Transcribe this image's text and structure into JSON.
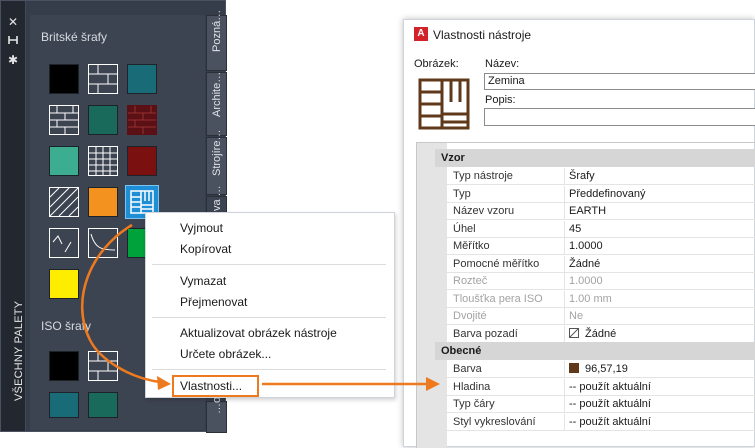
{
  "palette": {
    "title": "VŠECHNY PALETY",
    "section1_label": "Britské šrafy",
    "section2_label": "ISO šrafy",
    "tabs": [
      "Pozná…",
      "Archite…",
      "Strojíre…",
      "va …",
      "…oní"
    ],
    "colors": {
      "teal": "#1a6b78",
      "green": "#1a6a5c",
      "mint": "#3cae8f",
      "maroon": "#7b1010",
      "orange": "#f4921f",
      "yellow": "#ffed00",
      "black": "#000000",
      "brightgreen": "#00a23c",
      "highlight": "#1e8fd6"
    }
  },
  "context_menu": {
    "items": [
      "Vyjmout",
      "Kopírovat",
      "Vymazat",
      "Přejmenovat",
      "Aktualizovat obrázek nástroje",
      "Určete obrázek...",
      "Vlastnosti..."
    ],
    "highlight_color": "#ee7a1f"
  },
  "dialog": {
    "title": "Vlastnosti nástroje",
    "image_label": "Obrázek:",
    "name_label": "Název:",
    "name_value": "Zemina",
    "desc_label": "Popis:",
    "desc_value": "",
    "sections": [
      {
        "title": "Vzor",
        "rows": [
          {
            "name": "Typ nástroje",
            "value": "Šrafy",
            "gray": false
          },
          {
            "name": "Typ",
            "value": "Předdefinovaný",
            "gray": false
          },
          {
            "name": "Název vzoru",
            "value": "EARTH",
            "gray": false
          },
          {
            "name": "Úhel",
            "value": "45",
            "gray": false
          },
          {
            "name": "Měřítko",
            "value": "1.0000",
            "gray": false
          },
          {
            "name": "Pomocné měřítko",
            "value": "Žádné",
            "gray": false
          },
          {
            "name": "Rozteč",
            "value": "1.0000",
            "gray": true
          },
          {
            "name": "Tloušťka pera ISO",
            "value": "1.00 mm",
            "gray": true
          },
          {
            "name": "Dvojité",
            "value": "Ne",
            "gray": true
          },
          {
            "name": "Barva pozadí",
            "value": "Žádné",
            "gray": false
          }
        ]
      },
      {
        "title": "Obecné",
        "rows": [
          {
            "name": "Barva",
            "value": "96,57,19",
            "gray": false
          },
          {
            "name": "Hladina",
            "value": "-- použít aktuální",
            "gray": false
          },
          {
            "name": "Typ čáry",
            "value": "-- použít aktuální",
            "gray": false
          },
          {
            "name": "Styl vykreslování",
            "value": "-- použít aktuální",
            "gray": false
          }
        ]
      }
    ],
    "colors": {
      "accent": "#d2232a",
      "earth": "#60391a"
    }
  }
}
